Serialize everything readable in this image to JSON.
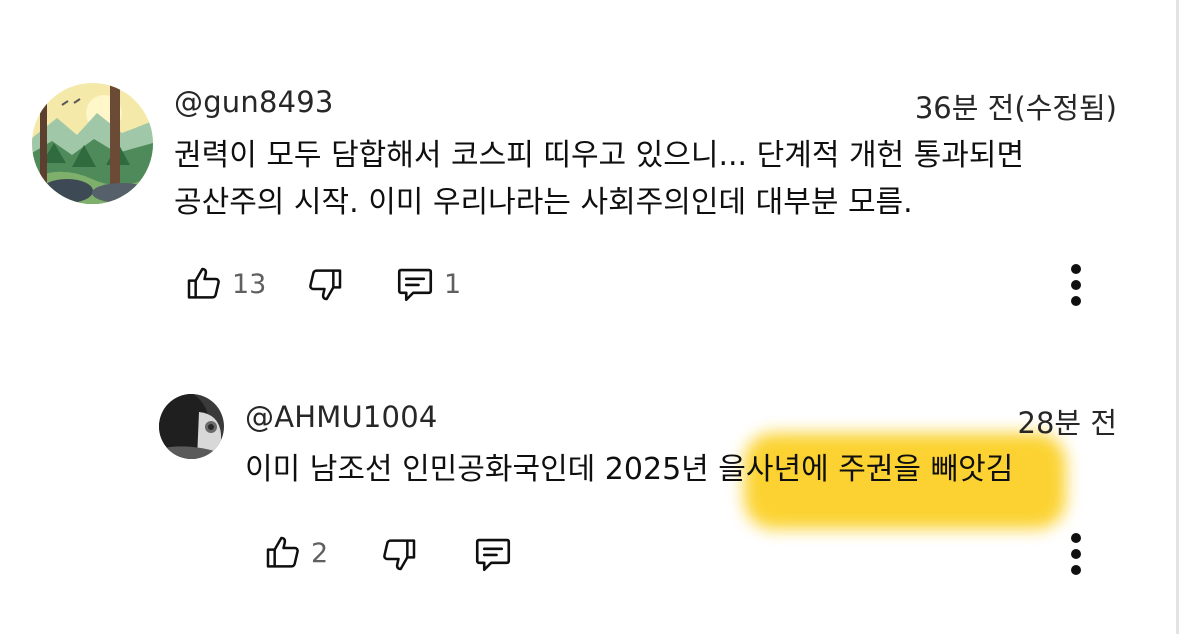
{
  "comments": [
    {
      "author": "@gun8493",
      "timestamp": "36분 전(수정됨)",
      "lines": [
        "권력이 모두 담합해서 코스피 띠우고 있으니... 단계적 개헌 통과되면",
        "공산주의 시작. 이미 우리나라는 사회주의인데 대부분 모름."
      ],
      "likes": "13",
      "replies": "1"
    }
  ],
  "reply": {
    "author": "@AHMU1004",
    "timestamp": "28분 전",
    "text": "이미 남조선 인민공화국인데 2025년 을사년에 주권을 빼앗김",
    "likes": "2"
  },
  "icons": {
    "like": "thumbs-up-icon",
    "dislike": "thumbs-down-icon",
    "reply": "comment-reply-icon",
    "more": "more-vertical-icon"
  },
  "colors": {
    "highlight": "#fbcf20",
    "text": "#0f0f0f",
    "meta": "#5f5f5f"
  }
}
